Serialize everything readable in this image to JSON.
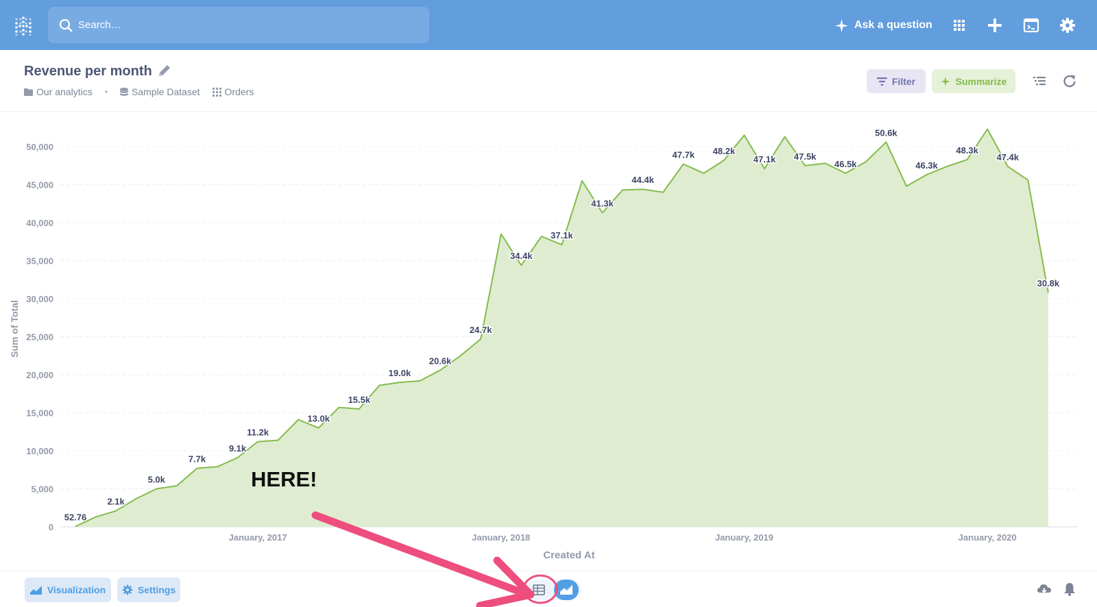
{
  "topbar": {
    "search_placeholder": "Search…",
    "ask_label": "Ask a question",
    "bg_color": "#629dde"
  },
  "header": {
    "title": "Revenue per month",
    "breadcrumbs": [
      "Our analytics",
      "Sample Dataset",
      "Orders"
    ],
    "filter_label": "Filter",
    "summarize_label": "Summarize"
  },
  "annotation": {
    "label": "HERE!",
    "color": "#ed4e7e"
  },
  "footer": {
    "visualization_label": "Visualization",
    "settings_label": "Settings"
  },
  "chart_data": {
    "type": "area",
    "xlabel": "Created At",
    "ylabel": "Sum of Total",
    "ylim": [
      0,
      50000
    ],
    "yticks": [
      "0",
      "5,000",
      "10,000",
      "15,000",
      "20,000",
      "25,000",
      "30,000",
      "35,000",
      "40,000",
      "45,000",
      "50,000"
    ],
    "ytick_values": [
      0,
      5000,
      10000,
      15000,
      20000,
      25000,
      30000,
      35000,
      40000,
      45000,
      50000
    ],
    "xticks": [
      {
        "label": "January, 2017",
        "index": 9
      },
      {
        "label": "January, 2018",
        "index": 21
      },
      {
        "label": "January, 2019",
        "index": 33
      },
      {
        "label": "January, 2020",
        "index": 45
      }
    ],
    "color": "#84bb4c",
    "fill": "#dfeccf",
    "x": [
      "2016-04",
      "2016-05",
      "2016-06",
      "2016-07",
      "2016-08",
      "2016-09",
      "2016-10",
      "2016-11",
      "2016-12",
      "2017-01",
      "2017-02",
      "2017-03",
      "2017-04",
      "2017-05",
      "2017-06",
      "2017-07",
      "2017-08",
      "2017-09",
      "2017-10",
      "2017-11",
      "2017-12",
      "2018-01",
      "2018-02",
      "2018-03",
      "2018-04",
      "2018-05",
      "2018-06",
      "2018-07",
      "2018-08",
      "2018-09",
      "2018-10",
      "2018-11",
      "2018-12",
      "2019-01",
      "2019-02",
      "2019-03",
      "2019-04",
      "2019-05",
      "2019-06",
      "2019-07",
      "2019-08",
      "2019-09",
      "2019-10",
      "2019-11",
      "2019-12",
      "2020-01",
      "2020-02",
      "2020-03",
      "2020-04"
    ],
    "values": [
      52.76,
      1300,
      2100,
      3700,
      5000,
      5400,
      7700,
      7900,
      9100,
      11200,
      11400,
      14100,
      13000,
      15700,
      15500,
      18600,
      19000,
      19200,
      20600,
      22500,
      24700,
      38500,
      34400,
      38200,
      37100,
      45500,
      41300,
      44300,
      44400,
      44000,
      47700,
      46500,
      48200,
      51500,
      47100,
      51300,
      47500,
      47800,
      46500,
      48000,
      50600,
      44800,
      46300,
      47400,
      48300,
      52300,
      47400,
      45600,
      30800
    ],
    "labels": [
      "52.76",
      "",
      "2.1k",
      "",
      "5.0k",
      "",
      "7.7k",
      "",
      "9.1k",
      "11.2k",
      "",
      "",
      "13.0k",
      "",
      "15.5k",
      "",
      "19.0k",
      "",
      "20.6k",
      "",
      "24.7k",
      "",
      "34.4k",
      "",
      "37.1k",
      "",
      "41.3k",
      "",
      "44.4k",
      "",
      "47.7k",
      "",
      "48.2k",
      "",
      "47.1k",
      "",
      "47.5k",
      "",
      "46.5k",
      "",
      "50.6k",
      "",
      "46.3k",
      "",
      "48.3k",
      "",
      "47.4k",
      "",
      "30.8k"
    ]
  }
}
